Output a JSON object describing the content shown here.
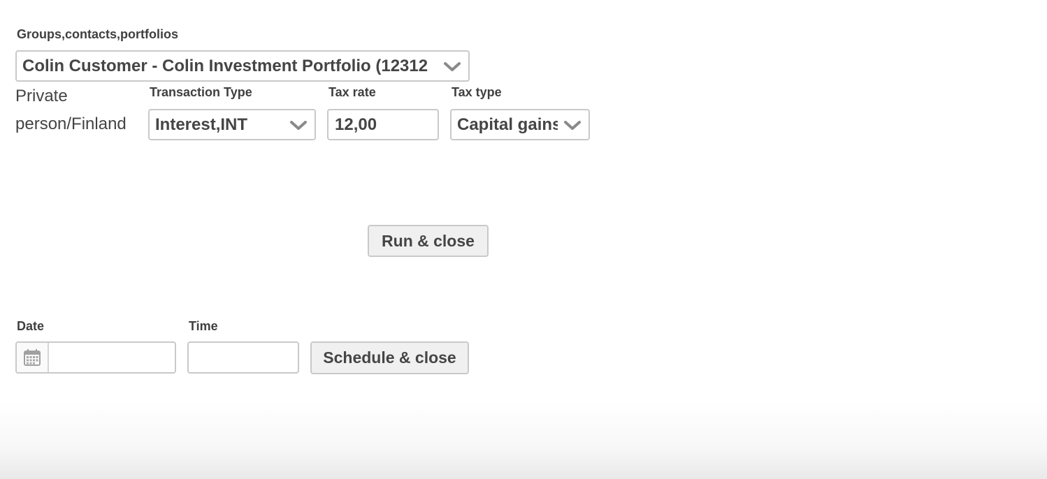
{
  "form": {
    "portfolio_label": "Groups,contacts,portfolios",
    "portfolio_value": "Colin Customer - Colin Investment Portfolio (12312",
    "person_type_line1": "Private",
    "person_type_line2": "person/Finland",
    "transaction_type_label": "Transaction Type",
    "transaction_type_value": "Interest,INT",
    "tax_rate_label": "Tax rate",
    "tax_rate_value": "12,00",
    "tax_type_label": "Tax type",
    "tax_type_value": "Capital gains"
  },
  "actions": {
    "run_close_label": "Run & close",
    "schedule_close_label": "Schedule & close"
  },
  "schedule": {
    "date_label": "Date",
    "date_value": "",
    "time_label": "Time",
    "time_value": ""
  },
  "icons": {
    "dropdown": "chevron-down-icon",
    "calendar": "calendar-icon"
  },
  "colors": {
    "border": "#c9c9c9",
    "button_bg": "#f0f0f0",
    "text": "#454545"
  }
}
